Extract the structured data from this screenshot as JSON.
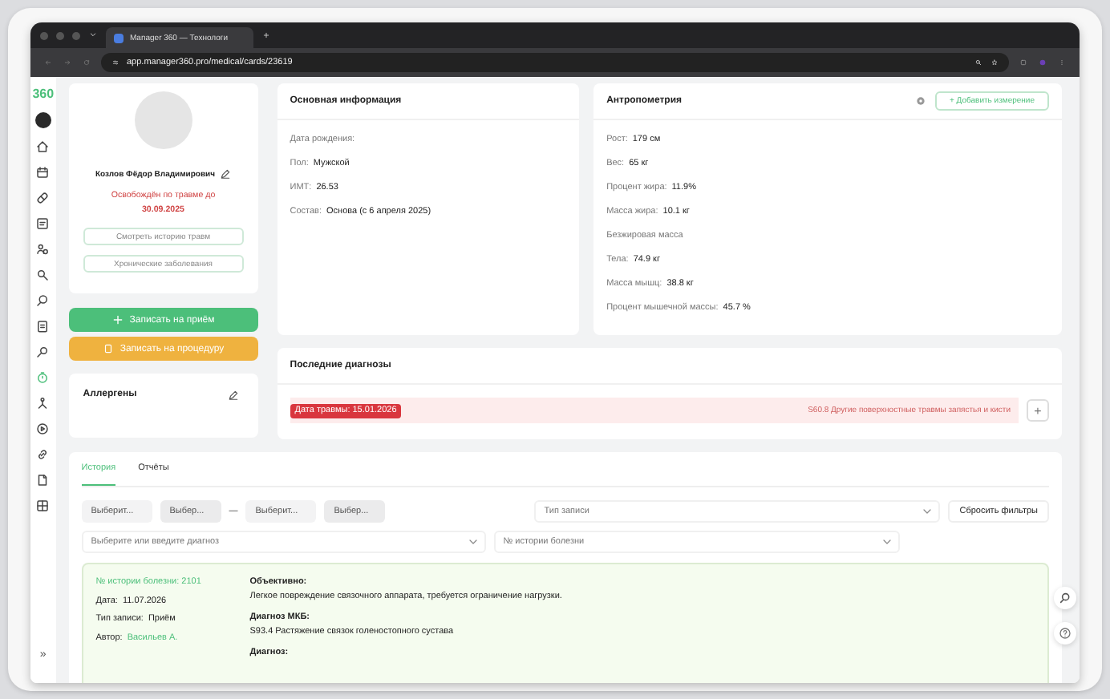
{
  "browser": {
    "tab_title": "Manager 360 — Технологи",
    "url": "app.manager360.pro/medical/cards/23619"
  },
  "sidebar": {
    "logo": "360",
    "items": [
      {
        "selected": false
      },
      {
        "selected": false
      },
      {
        "selected": false
      },
      {
        "selected": false
      },
      {
        "selected": false
      },
      {
        "selected": false
      },
      {
        "selected": false
      },
      {
        "selected": false
      },
      {
        "selected": false
      },
      {
        "selected": true
      },
      {
        "selected": false
      },
      {
        "selected": false
      },
      {
        "selected": false
      },
      {
        "selected": false
      },
      {
        "selected": false
      }
    ],
    "collapse": "»"
  },
  "patient": {
    "name": "Козлов Фёдор Владимирович",
    "status": "Освобождён по травме до **30.09.2025**",
    "links": [
      "Смотреть историю травм",
      "Хронические заболевания"
    ],
    "actions": [
      {
        "label": "Записать на приём",
        "kind": "primary"
      },
      {
        "label": "Записать на процедуру",
        "kind": "warning"
      }
    ],
    "allergens_title": "Аллергены"
  },
  "basic_info": {
    "title": "Основная информация",
    "rows": [
      {
        "label": "Дата рождения:"
      },
      {
        "label": "Пол:",
        "value": "Мужской"
      },
      {
        "label": "ИМТ:",
        "value": "26.53"
      },
      {
        "label": "Состав:",
        "value": "Основа (с 6 апреля 2025)"
      }
    ]
  },
  "anthropometry": {
    "title": "Антропометрия",
    "add_button": "+ Добавить измерение",
    "rows": [
      {
        "label": "Рост:",
        "value": "179 см"
      },
      {
        "label": "Вес:",
        "value": "65 кг"
      },
      {
        "label": "Процент жира:",
        "value": "11.9%"
      },
      {
        "label": "Масса жира:",
        "value": "10.1 кг"
      },
      {
        "label": "Безжировая масса"
      },
      {
        "label": "Тела:",
        "value": "74.9 кг"
      },
      {
        "label": "Масса мышц:",
        "value": "38.8 кг"
      },
      {
        "label": "Процент мышечной массы:",
        "value": "45.7 %"
      }
    ]
  },
  "diagnoses": {
    "title": "Последние диагнозы",
    "items": [
      {
        "tag": "Дата травмы: 15.01.2026",
        "text": "S60.8 Другие поверхностные травмы запястья и кисти"
      }
    ],
    "add": "+"
  },
  "history": {
    "tabs": [
      {
        "label": "История",
        "selected": true
      },
      {
        "label": "Отчёты",
        "selected": false
      }
    ],
    "filters": {
      "date_from": [
        "Выберит...",
        "Выбер..."
      ],
      "separator": "—",
      "date_to": [
        "Выберит...",
        "Выбер..."
      ],
      "record_type": {
        "placeholder": "Тип записи"
      },
      "reset": "Сбросить фильтры",
      "diagnosis": {
        "placeholder": "Выберите или введите диагноз"
      },
      "case_number": {
        "placeholder": "№ истории болезни"
      }
    },
    "records": [
      {
        "number": "№ истории болезни: 2101",
        "fields": [
          {
            "label": "Дата:",
            "value": "11.07.2026",
            "kind": "text"
          },
          {
            "label": "Тип записи:",
            "value": "Приём",
            "kind": "text"
          },
          {
            "label": "Автор:",
            "value": "Васильев А.",
            "kind": "link"
          }
        ],
        "sections": [
          {
            "title": "Объективно:",
            "text": "Легкое повреждение связочного аппарата, требуется ограничение нагрузки."
          },
          {
            "title": "Диагноз МКБ:",
            "text": "S93.4 Растяжение связок голеностопного сустава"
          },
          {
            "title": "Диагноз:"
          }
        ]
      }
    ]
  }
}
